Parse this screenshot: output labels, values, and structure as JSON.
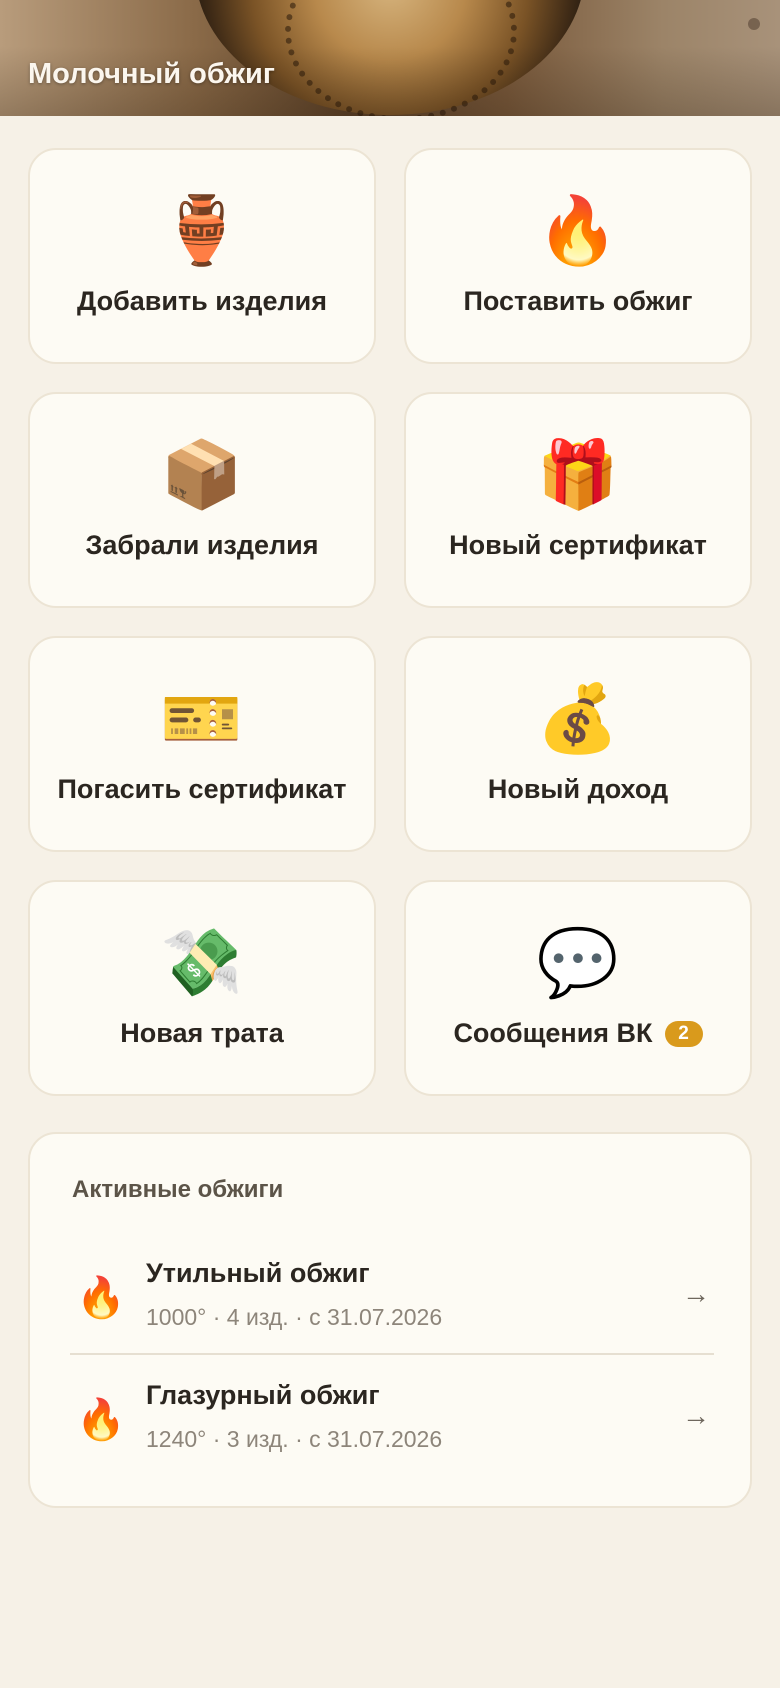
{
  "header": {
    "title": "Молочный обжиг"
  },
  "actions": [
    {
      "label": "Добавить изделия",
      "icon": "🏺",
      "icon_name": "amphora-icon"
    },
    {
      "label": "Поставить обжиг",
      "icon": "🔥",
      "icon_name": "fire-icon"
    },
    {
      "label": "Забрали изделия",
      "icon": "📦",
      "icon_name": "package-icon"
    },
    {
      "label": "Новый сертификат",
      "icon": "🎁",
      "icon_name": "gift-icon"
    },
    {
      "label": "Погасить сертификат",
      "icon": "🎫",
      "icon_name": "ticket-icon"
    },
    {
      "label": "Новый доход",
      "icon": "💰",
      "icon_name": "money-bag-icon"
    },
    {
      "label": "Новая трата",
      "icon": "💸",
      "icon_name": "money-wings-icon"
    },
    {
      "label": "Сообщения ВК",
      "icon": "💬",
      "icon_name": "speech-bubble-icon",
      "badge": "2"
    }
  ],
  "active_firings": {
    "title": "Активные обжиги",
    "items": [
      {
        "icon": "🔥",
        "name": "Утильный обжиг",
        "meta": "1000° · 4 изд. · с 31.07.2026",
        "arrow": "→"
      },
      {
        "icon": "🔥",
        "name": "Глазурный обжиг",
        "meta": "1240° · 3 изд. · с 31.07.2026",
        "arrow": "→"
      }
    ]
  },
  "colors": {
    "background": "#f6f1e7",
    "card": "#fdfbf4",
    "badge": "#d99a1c",
    "text": "#2b2620",
    "muted": "#8d857a"
  }
}
